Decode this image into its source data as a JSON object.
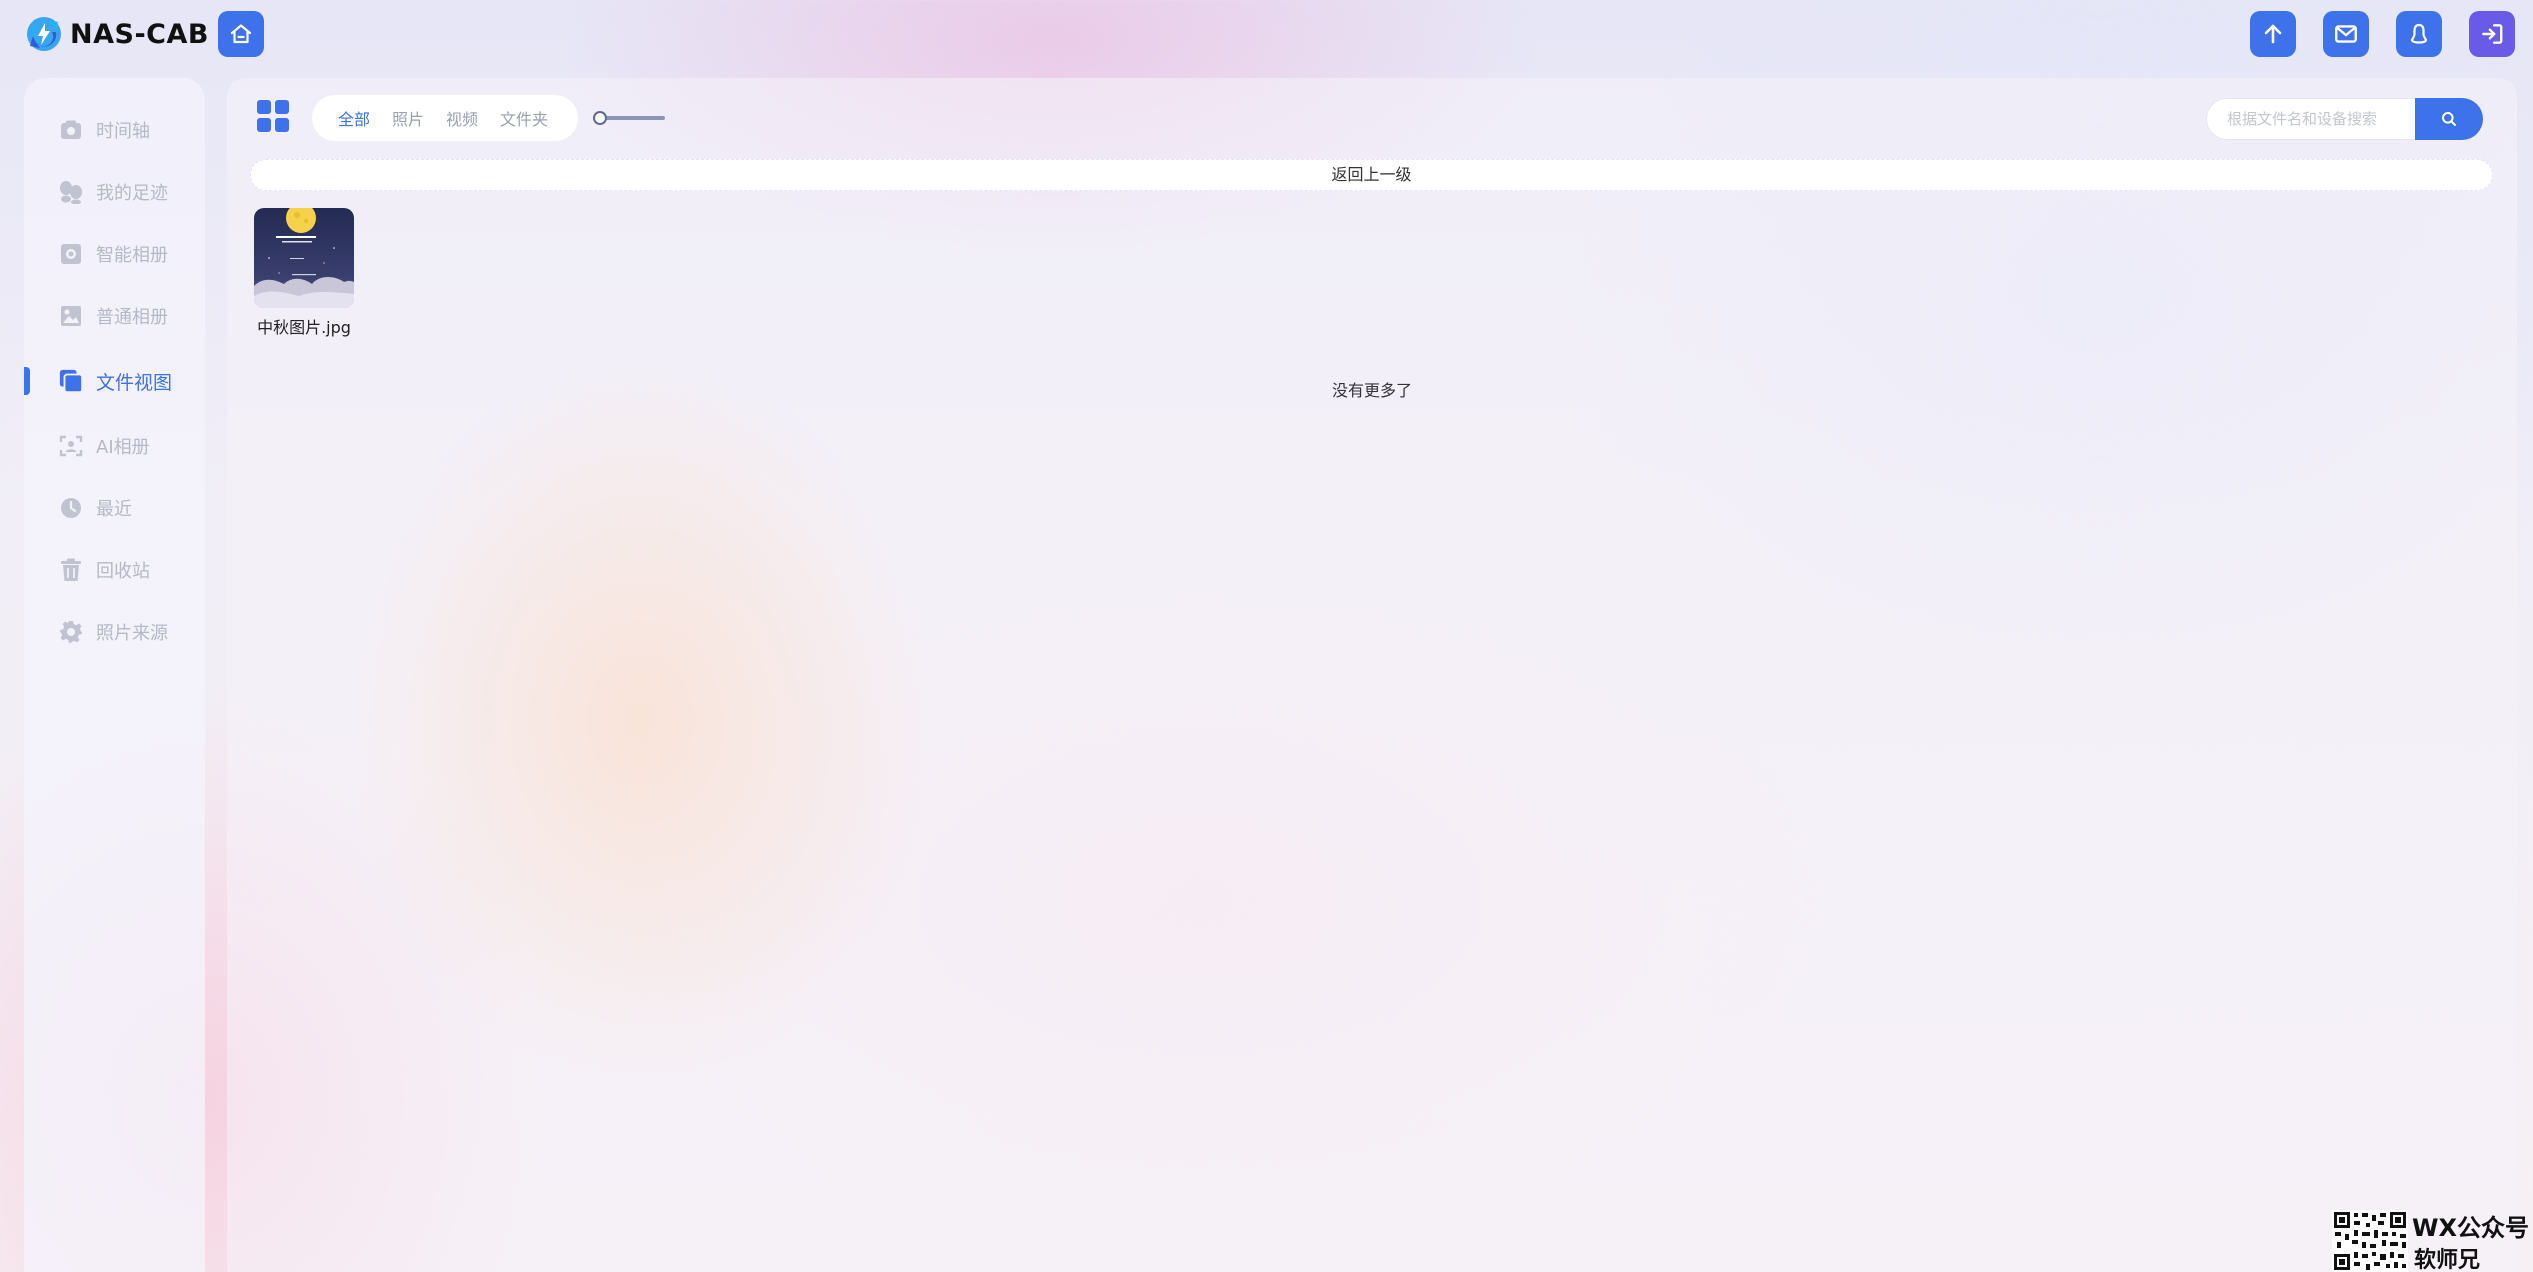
{
  "app": {
    "name": "NAS-CAB"
  },
  "colors": {
    "accent": "#3d72ea",
    "logout": "#6a5ae8",
    "inactive_text": "#b4b9c8"
  },
  "header": {
    "home_icon": "home-icon",
    "actions": [
      {
        "name": "upload",
        "icon": "arrow-up-icon"
      },
      {
        "name": "messages",
        "icon": "mail-icon"
      },
      {
        "name": "user",
        "icon": "user-icon"
      },
      {
        "name": "logout",
        "icon": "logout-icon"
      }
    ]
  },
  "sidebar": {
    "items": [
      {
        "label": "时间轴",
        "icon": "camera-icon",
        "active": false
      },
      {
        "label": "我的足迹",
        "icon": "footprint-icon",
        "active": false
      },
      {
        "label": "智能相册",
        "icon": "smart-album-icon",
        "active": false
      },
      {
        "label": "普通相册",
        "icon": "image-icon",
        "active": false
      },
      {
        "label": "文件视图",
        "icon": "copy-icon",
        "active": true
      },
      {
        "label": "AI相册",
        "icon": "face-scan-icon",
        "active": false
      },
      {
        "label": "最近",
        "icon": "clock-icon",
        "active": false
      },
      {
        "label": "回收站",
        "icon": "trash-icon",
        "active": false
      },
      {
        "label": "照片来源",
        "icon": "gear-icon",
        "active": false
      }
    ]
  },
  "toolbar": {
    "view_icon": "grid-icon",
    "tabs": [
      {
        "label": "全部",
        "active": true
      },
      {
        "label": "照片",
        "active": false
      },
      {
        "label": "视频",
        "active": false
      },
      {
        "label": "文件夹",
        "active": false
      }
    ],
    "zoom_slider_value": 0,
    "search": {
      "placeholder": "根据文件名和设备搜索",
      "value": "",
      "button_icon": "search-icon"
    }
  },
  "content": {
    "back_label": "返回上一级",
    "files": [
      {
        "name": "中秋图片.jpg",
        "type": "image"
      }
    ],
    "end_message": "没有更多了"
  },
  "watermark": {
    "line1": "WX公众号",
    "line2": "软师兄"
  }
}
